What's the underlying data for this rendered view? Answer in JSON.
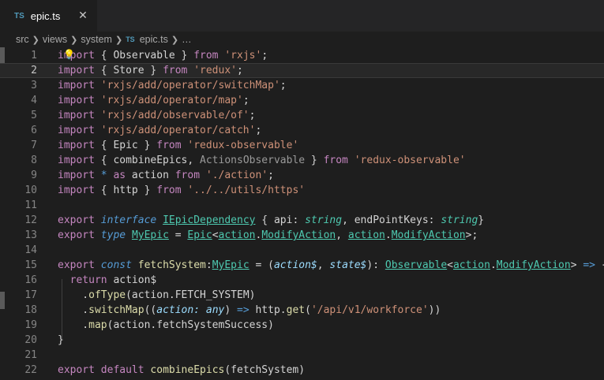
{
  "tab": {
    "icon": "TS",
    "title": "epic.ts",
    "close_glyph": "✕"
  },
  "breadcrumb": {
    "items": [
      "src",
      "views",
      "system"
    ],
    "file_icon": "TS",
    "file": "epic.ts",
    "more": "…"
  },
  "editor": {
    "current_line": 2,
    "lines": [
      {
        "n": "1",
        "tokens": [
          [
            "k",
            "import"
          ],
          [
            "v",
            " { Observable } "
          ],
          [
            "k",
            "from"
          ],
          [
            "v",
            " "
          ],
          [
            "s",
            "'rxjs'"
          ],
          [
            "v",
            ";"
          ]
        ]
      },
      {
        "n": "2",
        "tokens": [
          [
            "k",
            "import"
          ],
          [
            "v",
            " { Store } "
          ],
          [
            "k",
            "from"
          ],
          [
            "v",
            " "
          ],
          [
            "s",
            "'redux'"
          ],
          [
            "v",
            ";"
          ]
        ]
      },
      {
        "n": "3",
        "tokens": [
          [
            "k",
            "import"
          ],
          [
            "v",
            " "
          ],
          [
            "s",
            "'rxjs/add/operator/switchMap'"
          ],
          [
            "v",
            ";"
          ]
        ]
      },
      {
        "n": "4",
        "tokens": [
          [
            "k",
            "import"
          ],
          [
            "v",
            " "
          ],
          [
            "s",
            "'rxjs/add/operator/map'"
          ],
          [
            "v",
            ";"
          ]
        ]
      },
      {
        "n": "5",
        "tokens": [
          [
            "k",
            "import"
          ],
          [
            "v",
            " "
          ],
          [
            "s",
            "'rxjs/add/observable/of'"
          ],
          [
            "v",
            ";"
          ]
        ]
      },
      {
        "n": "6",
        "tokens": [
          [
            "k",
            "import"
          ],
          [
            "v",
            " "
          ],
          [
            "s",
            "'rxjs/add/operator/catch'"
          ],
          [
            "v",
            ";"
          ]
        ]
      },
      {
        "n": "7",
        "tokens": [
          [
            "k",
            "import"
          ],
          [
            "v",
            " { Epic } "
          ],
          [
            "k",
            "from"
          ],
          [
            "v",
            " "
          ],
          [
            "s",
            "'redux-observable'"
          ]
        ]
      },
      {
        "n": "8",
        "tokens": [
          [
            "k",
            "import"
          ],
          [
            "v",
            " { combineEpics, "
          ],
          [
            "dim",
            "ActionsObservable"
          ],
          [
            "v",
            " } "
          ],
          [
            "k",
            "from"
          ],
          [
            "v",
            " "
          ],
          [
            "s",
            "'redux-observable'"
          ]
        ]
      },
      {
        "n": "9",
        "tokens": [
          [
            "k",
            "import"
          ],
          [
            "v",
            " "
          ],
          [
            "kw",
            "*"
          ],
          [
            "v",
            " "
          ],
          [
            "k",
            "as"
          ],
          [
            "v",
            " action "
          ],
          [
            "k",
            "from"
          ],
          [
            "v",
            " "
          ],
          [
            "s",
            "'./action'"
          ],
          [
            "v",
            ";"
          ]
        ]
      },
      {
        "n": "10",
        "tokens": [
          [
            "k",
            "import"
          ],
          [
            "v",
            " { http } "
          ],
          [
            "k",
            "from"
          ],
          [
            "v",
            " "
          ],
          [
            "s",
            "'../../utils/https'"
          ]
        ]
      },
      {
        "n": "11",
        "tokens": []
      },
      {
        "n": "12",
        "tokens": [
          [
            "k",
            "export"
          ],
          [
            "v",
            " "
          ],
          [
            "kwi",
            "interface"
          ],
          [
            "v",
            " "
          ],
          [
            "tu",
            "IEpicDependency"
          ],
          [
            "v",
            " { api: "
          ],
          [
            "ti",
            "string"
          ],
          [
            "v",
            ", endPointKeys: "
          ],
          [
            "ti",
            "string"
          ],
          [
            "v",
            "}"
          ]
        ]
      },
      {
        "n": "13",
        "tokens": [
          [
            "k",
            "export"
          ],
          [
            "v",
            " "
          ],
          [
            "kwi",
            "type"
          ],
          [
            "v",
            " "
          ],
          [
            "tu",
            "MyEpic"
          ],
          [
            "v",
            " = "
          ],
          [
            "tu",
            "Epic"
          ],
          [
            "v",
            "<"
          ],
          [
            "tu",
            "action"
          ],
          [
            "v",
            "."
          ],
          [
            "tu",
            "ModifyAction"
          ],
          [
            "v",
            ", "
          ],
          [
            "tu",
            "action"
          ],
          [
            "v",
            "."
          ],
          [
            "tu",
            "ModifyAction"
          ],
          [
            "v",
            ">;"
          ]
        ]
      },
      {
        "n": "14",
        "tokens": []
      },
      {
        "n": "15",
        "tokens": [
          [
            "k",
            "export"
          ],
          [
            "v",
            " "
          ],
          [
            "kwi",
            "const"
          ],
          [
            "v",
            " "
          ],
          [
            "f",
            "fetchSystem"
          ],
          [
            "v",
            ":"
          ],
          [
            "tu",
            "MyEpic"
          ],
          [
            "v",
            " = ("
          ],
          [
            "pi",
            "action$"
          ],
          [
            "v",
            ", "
          ],
          [
            "pi",
            "state$"
          ],
          [
            "v",
            "): "
          ],
          [
            "tu",
            "Observable"
          ],
          [
            "v",
            "<"
          ],
          [
            "tu",
            "action"
          ],
          [
            "v",
            "."
          ],
          [
            "tu",
            "ModifyAction"
          ],
          [
            "v",
            "> "
          ],
          [
            "kw",
            "=>"
          ],
          [
            "v",
            " {"
          ]
        ]
      },
      {
        "n": "16",
        "tokens": [
          [
            "v",
            "  "
          ],
          [
            "k",
            "return"
          ],
          [
            "v",
            " action$"
          ]
        ]
      },
      {
        "n": "17",
        "tokens": [
          [
            "v",
            "    ."
          ],
          [
            "f",
            "ofType"
          ],
          [
            "v",
            "(action.FETCH_SYSTEM)"
          ]
        ]
      },
      {
        "n": "18",
        "tokens": [
          [
            "v",
            "    ."
          ],
          [
            "f",
            "switchMap"
          ],
          [
            "v",
            "(("
          ],
          [
            "pi",
            "action: any"
          ],
          [
            "v",
            ") "
          ],
          [
            "kw",
            "=>"
          ],
          [
            "v",
            " http."
          ],
          [
            "f",
            "get"
          ],
          [
            "v",
            "("
          ],
          [
            "s",
            "'/api/v1/workforce'"
          ],
          [
            "v",
            "))"
          ]
        ]
      },
      {
        "n": "19",
        "tokens": [
          [
            "v",
            "    ."
          ],
          [
            "f",
            "map"
          ],
          [
            "v",
            "(action.fetchSystemSuccess)"
          ]
        ]
      },
      {
        "n": "20",
        "tokens": [
          [
            "v",
            "}"
          ]
        ]
      },
      {
        "n": "21",
        "tokens": []
      },
      {
        "n": "22",
        "tokens": [
          [
            "k",
            "export"
          ],
          [
            "v",
            " "
          ],
          [
            "k",
            "default"
          ],
          [
            "v",
            " "
          ],
          [
            "f",
            "combineEpics"
          ],
          [
            "v",
            "(fetchSystem)"
          ]
        ]
      }
    ]
  }
}
